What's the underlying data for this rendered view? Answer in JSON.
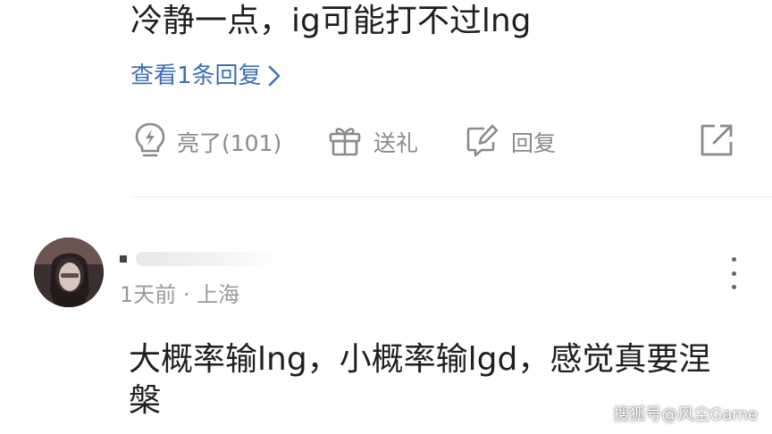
{
  "comment1": {
    "text": "冷静一点，ig可能打不过lng",
    "view_replies_label": "查看1条回复",
    "actions": {
      "like_label": "亮了(101)",
      "gift_label": "送礼",
      "reply_label": "回复"
    }
  },
  "comment2": {
    "time_location": "1天前 · 上海",
    "text": "大概率输lng，小概率输lgd，感觉真要涅槃"
  },
  "watermark": "搜狐号@风尘Game",
  "colors": {
    "link": "#3d6fb5",
    "action_gray": "#8a8a8a",
    "text": "#1f1f1f",
    "meta_gray": "#9a9a9a"
  },
  "icons": [
    "bulb-lightning-icon",
    "gift-icon",
    "edit-reply-icon",
    "share-external-icon",
    "chevron-right-icon",
    "more-vertical-icon"
  ]
}
